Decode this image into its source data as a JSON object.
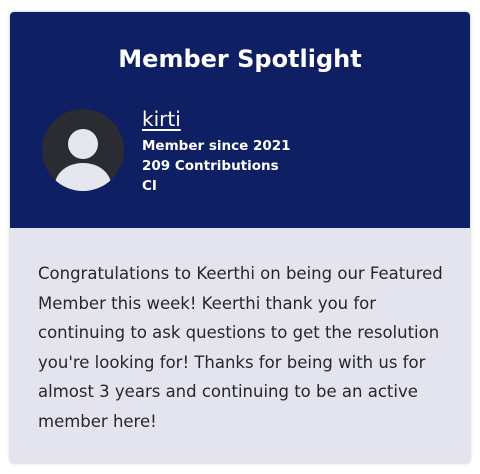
{
  "spotlight": {
    "title": "Member Spotlight",
    "avatar_icon": "default-user-avatar-icon",
    "member": {
      "username": "kirti",
      "member_since": "Member since 2021",
      "contributions": "209 Contributions",
      "rank": "CI"
    },
    "message": "Congratulations to Keerthi on being our Featured Member this week! Keerthi thank you for continuing to ask questions to get the resolution you're looking for! Thanks for being with us for almost 3 years and continuing to be an active member here!"
  },
  "colors": {
    "header_background": "#0e1f63",
    "body_background": "#e3e4ee",
    "avatar_background": "#2b2b33",
    "avatar_figure": "#e6e6ee",
    "text_dark": "#26262b"
  }
}
